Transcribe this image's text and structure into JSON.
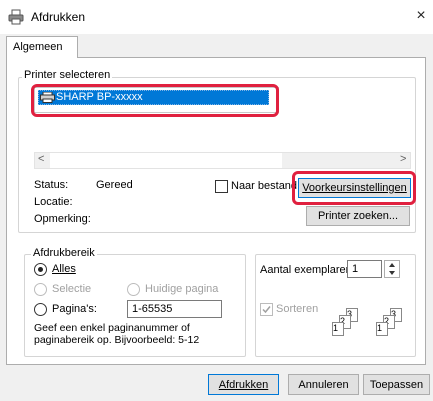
{
  "window": {
    "title": "Afdrukken",
    "close_glyph": "×",
    "icon": "printer-icon"
  },
  "tabs": [
    {
      "label": "Algemeen",
      "active": true
    }
  ],
  "printer_select": {
    "legend": "Printer selecteren",
    "printers": [
      {
        "name": "SHARP BP-xxxxx",
        "selected": true
      }
    ],
    "scroll_left": "<",
    "scroll_right": ">"
  },
  "status": {
    "status_label": "Status:",
    "status_value": "Gereed",
    "location_label": "Locatie:",
    "location_value": "",
    "comment_label": "Opmerking:",
    "comment_value": "",
    "print_to_file_label": "Naar bestand",
    "print_to_file_checked": false,
    "preferences_button": "Voorkeursinstellingen",
    "find_printer_button": "Printer zoeken..."
  },
  "page_range": {
    "legend": "Afdrukbereik",
    "all_label": "Alles",
    "selection_label": "Selectie",
    "current_page_label": "Huidige pagina",
    "pages_label": "Pagina's:",
    "pages_value": "1-65535",
    "selected": "all",
    "hint": "Geef een enkel paginanummer of paginabereik op. Bijvoorbeeld: 5-12"
  },
  "copies": {
    "label": "Aantal exemplaren:",
    "value": "1",
    "collate_label": "Sorteren",
    "collate_checked": true,
    "collate_disabled": true,
    "stack_labels": [
      "1",
      "2",
      "3"
    ]
  },
  "footer": {
    "print_button": "Afdrukken",
    "cancel_button": "Annuleren",
    "apply_button": "Toepassen"
  },
  "colors": {
    "highlight": "#e0203f",
    "selection": "#0078d7"
  }
}
